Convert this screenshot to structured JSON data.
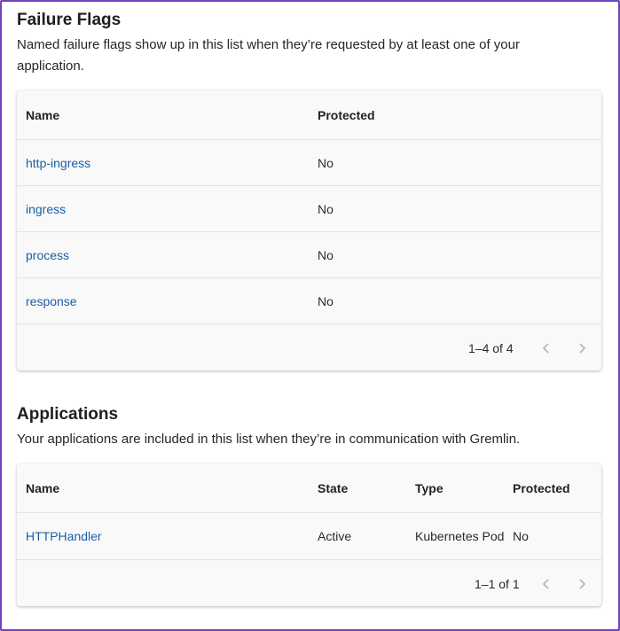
{
  "failure_flags": {
    "title": "Failure Flags",
    "description_line1": "Named failure flags show up in this list when they’re requested by at least one of your",
    "description_line2": "application.",
    "columns": [
      "Name",
      "Protected"
    ],
    "rows": [
      {
        "name": "http-ingress",
        "protected": "No"
      },
      {
        "name": "ingress",
        "protected": "No"
      },
      {
        "name": "process",
        "protected": "No"
      },
      {
        "name": "response",
        "protected": "No"
      }
    ],
    "pagination": "1–4 of 4"
  },
  "applications": {
    "title": "Applications",
    "description": "Your applications are included in this list when they’re in communication with Gremlin.",
    "columns": [
      "Name",
      "State",
      "Type",
      "Protected"
    ],
    "rows": [
      {
        "name": "HTTPHandler",
        "state": "Active",
        "type": "Kubernetes Pod",
        "protected": "No"
      }
    ],
    "pagination": "1–1 of 1"
  },
  "colors": {
    "link": "#1a5ea8",
    "frame_border": "#6f42c1",
    "card_background": "#f9f9f9"
  },
  "icons": {
    "prev": "chevron-left-icon",
    "next": "chevron-right-icon"
  }
}
